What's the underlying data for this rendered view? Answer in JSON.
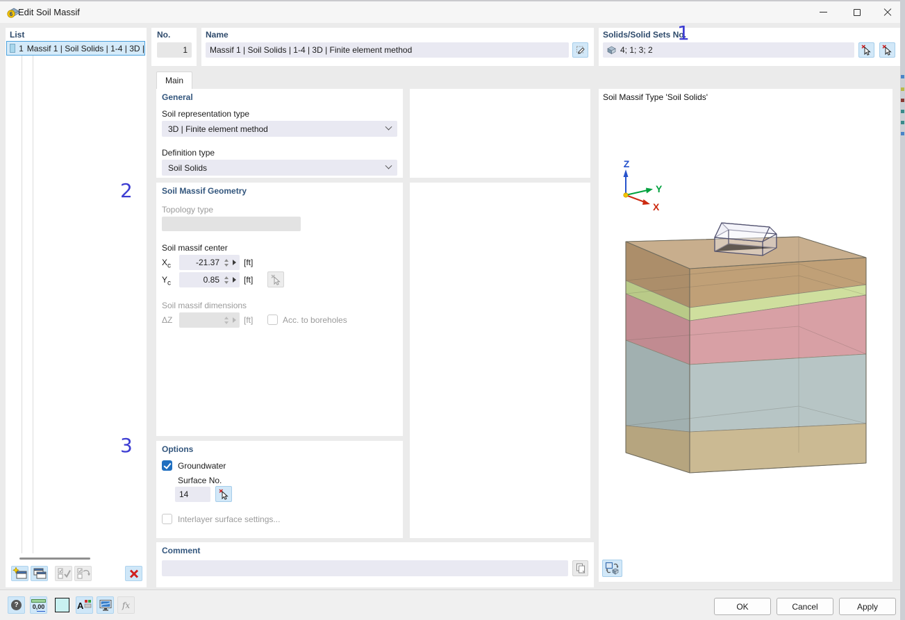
{
  "titlebar": {
    "title": "Edit Soil Massif",
    "icon_badge": "6"
  },
  "annotations": {
    "solids": "1",
    "geometry": "2",
    "options": "3",
    "color": "#3c3cd2"
  },
  "list_panel": {
    "header": "List",
    "selected_item": {
      "no": "1",
      "label": "Massif 1 | Soil Solids | 1-4 | 3D |",
      "swatch_color": "#a9d7ec"
    }
  },
  "header_fields": {
    "no_label": "No.",
    "no_value": "1",
    "name_label": "Name",
    "name_value": "Massif 1 | Soil Solids | 1-4 | 3D | Finite element method",
    "solids_label": "Solids/Solid Sets No.",
    "solids_value": "4; 1; 3; 2"
  },
  "tabs": {
    "main": "Main"
  },
  "general": {
    "header": "General",
    "representation_label": "Soil representation type",
    "representation_value": "3D | Finite element method",
    "definition_label": "Definition type",
    "definition_value": "Soil Solids"
  },
  "geometry": {
    "header": "Soil Massif Geometry",
    "topology_label": "Topology type",
    "topology_value": "",
    "center_label": "Soil massif center",
    "xc_label": "X",
    "xc_sub": "c",
    "xc_value": "-21.37",
    "xc_unit": "[ft]",
    "yc_label": "Y",
    "yc_sub": "c",
    "yc_value": "0.85",
    "yc_unit": "[ft]",
    "dimensions_label": "Soil massif dimensions",
    "dz_label": "ΔZ",
    "dz_value": "",
    "dz_unit": "[ft]",
    "boreholes_label": "Acc. to boreholes",
    "boreholes_checked": false
  },
  "options": {
    "header": "Options",
    "groundwater_label": "Groundwater",
    "groundwater_checked": true,
    "surface_label": "Surface No.",
    "surface_value": "14",
    "interlayer_label": "Interlayer surface settings...",
    "interlayer_checked": false
  },
  "comment": {
    "header": "Comment",
    "value": ""
  },
  "preview": {
    "title": "Soil Massif Type 'Soil Solids'",
    "axes": {
      "x_label": "X",
      "x_color": "#cc2a10",
      "y_label": "Y",
      "y_color": "#00a13e",
      "z_label": "Z",
      "z_color": "#2753cc"
    },
    "top_color": "#c8ae8d",
    "layers": [
      {
        "front": "#c0a077",
        "side": "#ac8e6a"
      },
      {
        "front": "#cfdf9e",
        "side": "#b9ca88"
      },
      {
        "front": "#d8a0a5",
        "side": "#c18b91"
      },
      {
        "front": "#b7c5c5",
        "side": "#a1b0b0"
      },
      {
        "front": "#cbba93",
        "side": "#b6a57f"
      }
    ]
  },
  "footer": {
    "ok": "OK",
    "cancel": "Cancel",
    "apply": "Apply"
  },
  "icons": {
    "help": "?",
    "decimal": "0,00",
    "fx": "fx"
  }
}
